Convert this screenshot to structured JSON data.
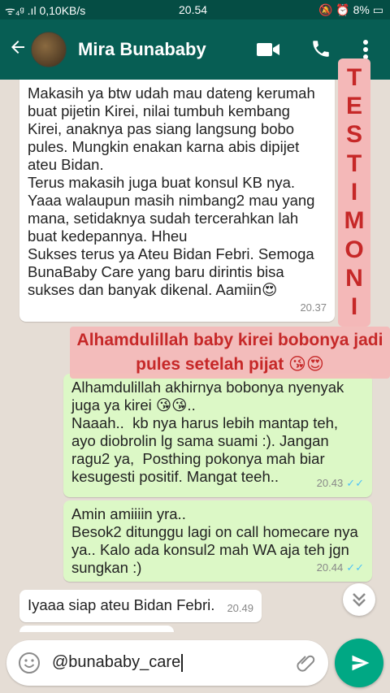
{
  "statusbar": {
    "left": "ᯤ₄ᵍ .ıl 0,10KB/s",
    "time": "20.54",
    "right": "🔕 ⏰ 8% ▭"
  },
  "header": {
    "contact_name": "Mira Bunababy"
  },
  "overlay": {
    "testimoni_letters": [
      "T",
      "E",
      "S",
      "T",
      "I",
      "M",
      "O",
      "N",
      "I"
    ],
    "caption_line1": "Alhamdulillah baby kirei bobonya jadi",
    "caption_line2": "pules setelah pijat 😘😍"
  },
  "messages": [
    {
      "direction": "in",
      "text": "Makasih ya btw udah mau dateng kerumah\nbuat pijetin Kirei, nilai tumbuh kembang\nKirei, anaknya pas siang langsung bobo\npules. Mungkin enakan karna abis dipijet\nateu Bidan.\nTerus makasih juga buat konsul KB nya.\nYaaa walaupun masih nimbang2 mau yang\nmana, setidaknya sudah tercerahkan lah\nbuat kedepannya. Hheu\nSukses terus ya Ateu Bidan Febri. Semoga\nBunaBaby Care yang baru dirintis bisa\nsukses dan banyak dikenal. Aamiin😍",
      "time": "20.37"
    },
    {
      "direction": "out",
      "text": "Alhamdulillah akhirnya bobonya nyenyak\njuga ya kirei 😘😘..\nNaaah..  kb nya harus lebih mantap teh,\nayo diobrolin lg sama suami :). Jangan\nragu2 ya,  Posthing pokonya mah biar\nkesugesti positif. Mangat teeh..",
      "time": "20.43",
      "ticks": "✓✓"
    },
    {
      "direction": "out",
      "text": "Amin amiiiin yra..\nBesok2 ditunggu lagi on call homecare nya\nya.. Kalo ada konsul2 mah WA aja teh jgn\nsungkan :)",
      "time": "20.44",
      "ticks": "✓✓"
    },
    {
      "direction": "in",
      "text": "Iyaaa siap ateu Bidan Febri.",
      "time": "20.49"
    }
  ],
  "input": {
    "value": "@bunababy_care"
  },
  "colors": {
    "header": "#075e54",
    "statusbar": "#054d44",
    "outgoing_bubble": "#dcf8c6",
    "send_button": "#00a884",
    "overlay_text": "#c62828",
    "overlay_bg": "#f4b8b8"
  }
}
